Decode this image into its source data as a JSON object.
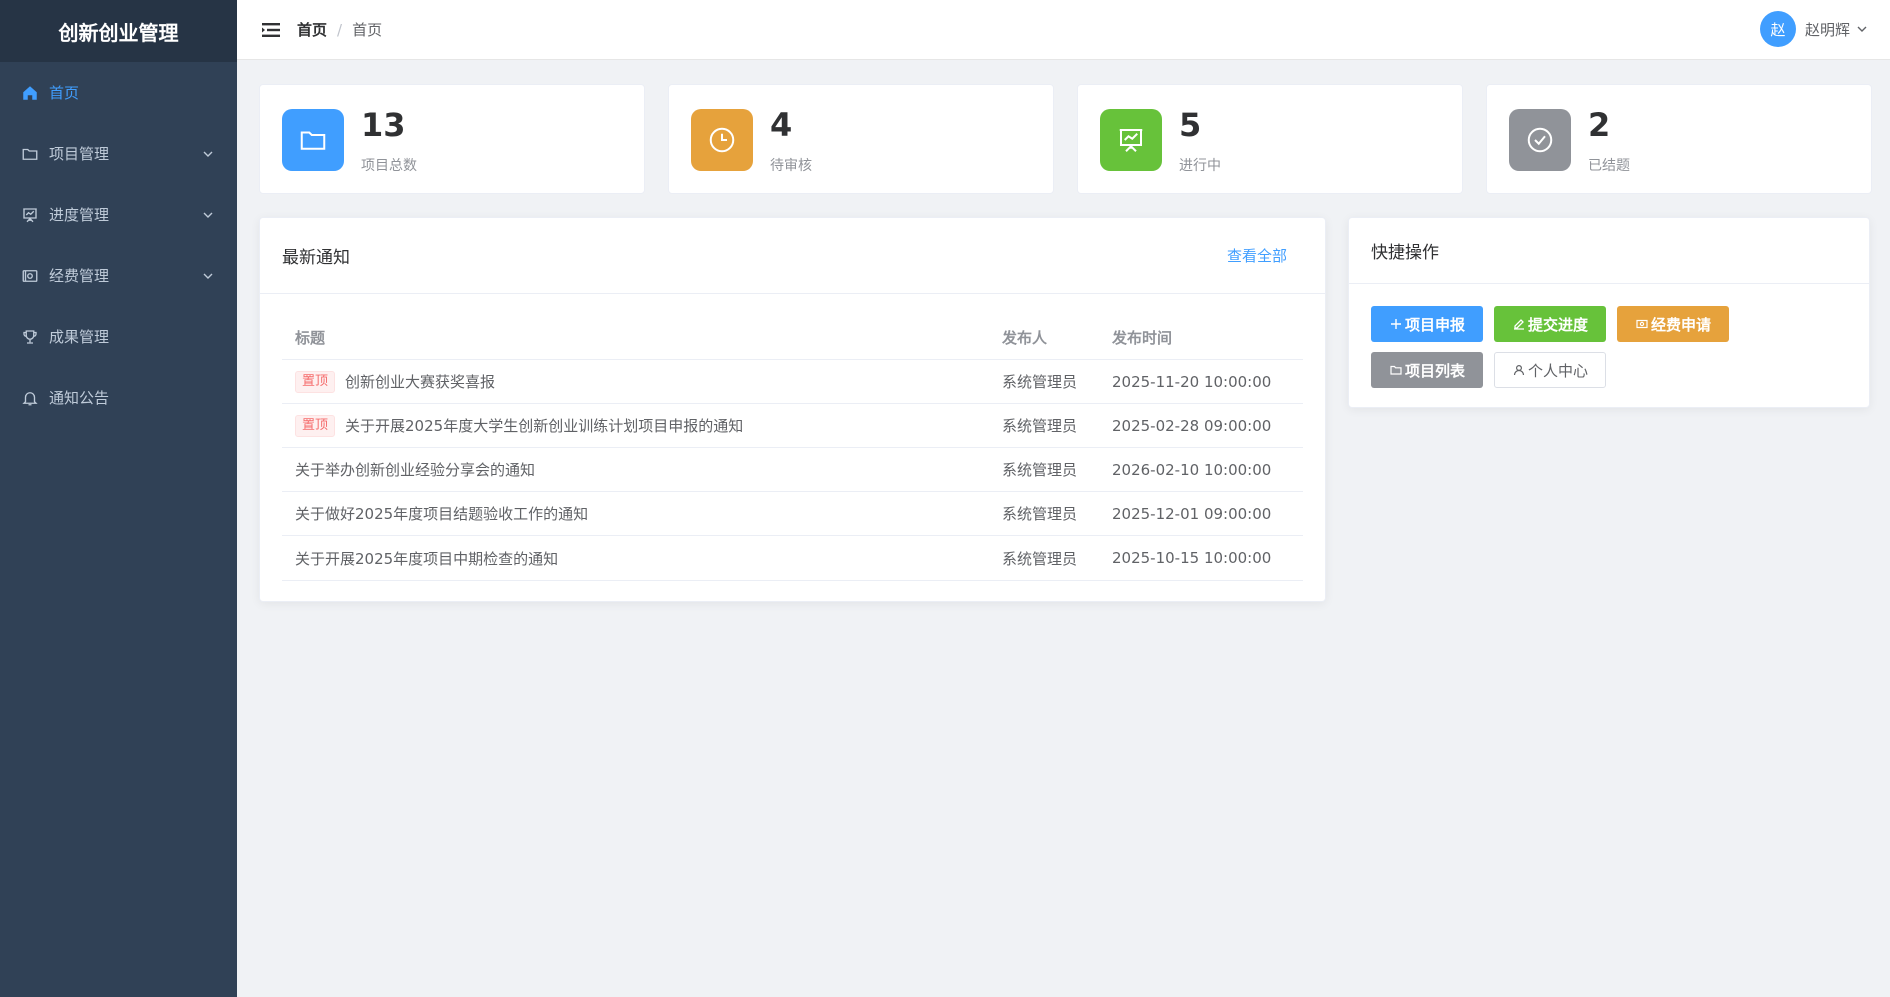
{
  "app": {
    "title": "创新创业管理"
  },
  "sidebar": {
    "items": [
      {
        "label": "首页",
        "icon": "home-icon",
        "active": true,
        "expandable": false
      },
      {
        "label": "项目管理",
        "icon": "folder-icon",
        "active": false,
        "expandable": true
      },
      {
        "label": "进度管理",
        "icon": "presentation-icon",
        "active": false,
        "expandable": true
      },
      {
        "label": "经费管理",
        "icon": "money-icon",
        "active": false,
        "expandable": true
      },
      {
        "label": "成果管理",
        "icon": "trophy-icon",
        "active": false,
        "expandable": false
      },
      {
        "label": "通知公告",
        "icon": "bell-icon",
        "active": false,
        "expandable": false
      }
    ]
  },
  "header": {
    "breadcrumb": [
      "首页",
      "首页"
    ],
    "breadcrumb_separator": "/",
    "user": {
      "avatar_text": "赵",
      "name": "赵明辉"
    }
  },
  "stats": [
    {
      "value": "13",
      "label": "项目总数",
      "color": "#409eff",
      "icon": "folder-icon"
    },
    {
      "value": "4",
      "label": "待审核",
      "color": "#e6a23c",
      "icon": "clock-icon"
    },
    {
      "value": "5",
      "label": "进行中",
      "color": "#67c23a",
      "icon": "presentation-icon"
    },
    {
      "value": "2",
      "label": "已结题",
      "color": "#909399",
      "icon": "check-circle-icon"
    }
  ],
  "notices": {
    "title": "最新通知",
    "view_all": "查看全部",
    "columns": [
      "标题",
      "发布人",
      "发布时间"
    ],
    "pin_label": "置顶",
    "rows": [
      {
        "pinned": true,
        "title": "创新创业大赛获奖喜报",
        "publisher": "系统管理员",
        "time": "2025-11-20 10:00:00"
      },
      {
        "pinned": true,
        "title": "关于开展2025年度大学生创新创业训练计划项目申报的通知",
        "publisher": "系统管理员",
        "time": "2025-02-28 09:00:00"
      },
      {
        "pinned": false,
        "title": "关于举办创新创业经验分享会的通知",
        "publisher": "系统管理员",
        "time": "2026-02-10 10:00:00"
      },
      {
        "pinned": false,
        "title": "关于做好2025年度项目结题验收工作的通知",
        "publisher": "系统管理员",
        "time": "2025-12-01 09:00:00"
      },
      {
        "pinned": false,
        "title": "关于开展2025年度项目中期检查的通知",
        "publisher": "系统管理员",
        "time": "2025-10-15 10:00:00"
      }
    ]
  },
  "quick_actions": {
    "title": "快捷操作",
    "buttons": [
      {
        "label": "项目申报",
        "icon": "plus-icon",
        "style": "primary"
      },
      {
        "label": "提交进度",
        "icon": "edit-icon",
        "style": "success"
      },
      {
        "label": "经费申请",
        "icon": "money-icon",
        "style": "warning"
      },
      {
        "label": "项目列表",
        "icon": "folder-icon",
        "style": "info"
      },
      {
        "label": "个人中心",
        "icon": "user-icon",
        "style": "default"
      }
    ]
  }
}
